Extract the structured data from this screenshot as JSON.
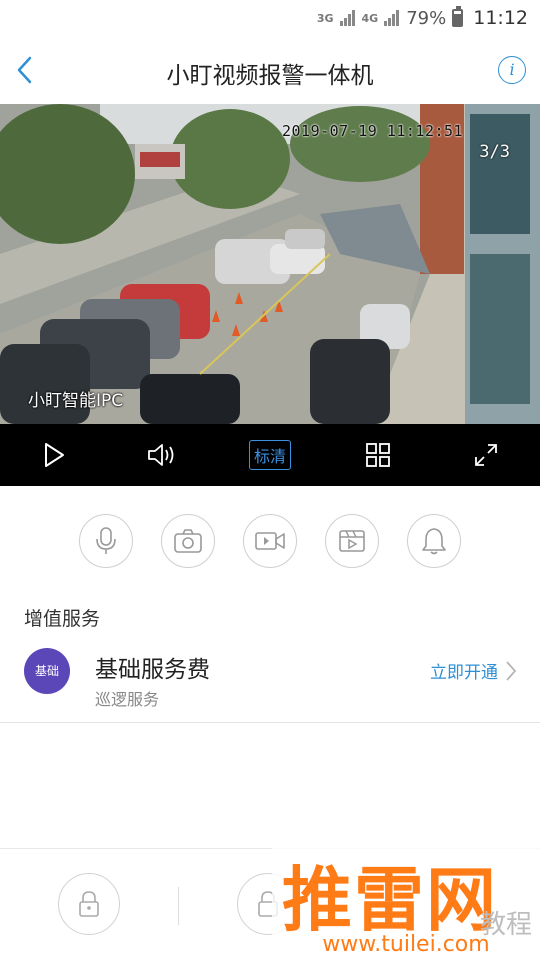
{
  "status_bar": {
    "network_1": "3G",
    "network_2": "4G",
    "battery": "79%",
    "time": "11:12"
  },
  "header": {
    "title": "小盯视频报警一体机",
    "back_icon": "chevron-left-icon",
    "info_icon": "info-icon"
  },
  "video": {
    "timestamp": "2019-07-19 11:12:51",
    "channel": "3/3",
    "camera_name": "小盯智能IPC"
  },
  "player_controls": {
    "play_icon": "play-icon",
    "volume_icon": "volume-icon",
    "quality_label": "标清",
    "grid_icon": "grid-icon",
    "fullscreen_icon": "fullscreen-icon"
  },
  "actions": [
    "microphone-icon",
    "camera-icon",
    "video-record-icon",
    "playback-icon",
    "bell-icon"
  ],
  "value_added": {
    "section_title": "增值服务",
    "service": {
      "badge": "基础",
      "name": "基础服务费",
      "subtitle": "巡逻服务",
      "action": "立即开通"
    }
  },
  "watermark": {
    "brand": "推雷网",
    "faint_text": "教程",
    "url": "www.tuilei.com"
  },
  "colors": {
    "accent": "#2f8fd6",
    "badge": "#5b47b8",
    "watermark": "#ff7b16"
  }
}
